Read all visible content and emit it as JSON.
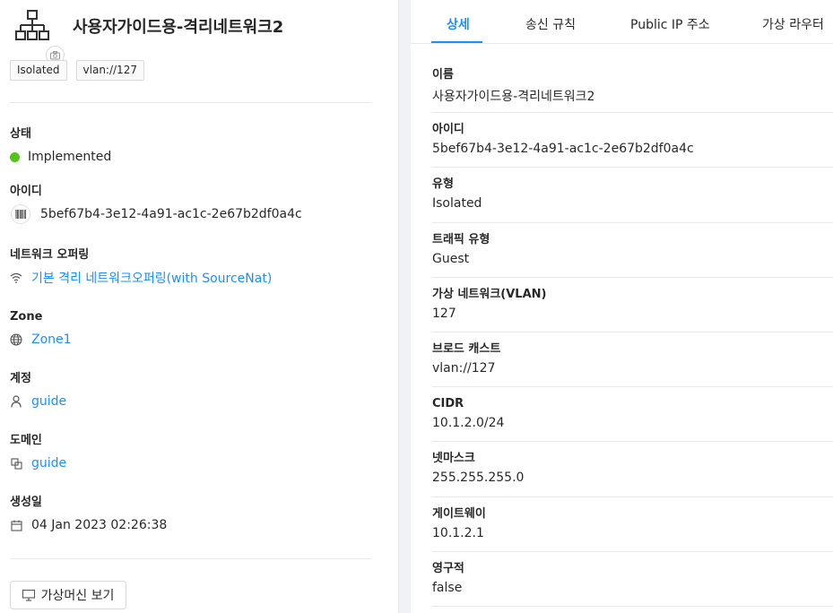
{
  "header": {
    "title": "사용자가이드용-격리네트워크2",
    "tags": [
      "Isolated",
      "vlan://127"
    ]
  },
  "info": {
    "status": {
      "label": "상태",
      "value": "Implemented",
      "color": "#52c41a"
    },
    "id": {
      "label": "아이디",
      "value": "5bef67b4-3e12-4a91-ac1c-2e67b2df0a4c"
    },
    "network_offering": {
      "label": "네트워크 오퍼링",
      "value": "기본 격리 네트워크오퍼링(with SourceNat)"
    },
    "zone": {
      "label": "Zone",
      "value": "Zone1"
    },
    "account": {
      "label": "계정",
      "value": "guide"
    },
    "domain": {
      "label": "도메인",
      "value": "guide"
    },
    "created": {
      "label": "생성일",
      "value": "04 Jan 2023 02:26:38"
    }
  },
  "actions": {
    "view_vms": "가상머신 보기"
  },
  "tabs": [
    "상세",
    "송신 규칙",
    "Public IP 주소",
    "가상 라우터"
  ],
  "details": [
    {
      "label": "이름",
      "value": "사용자가이드용-격리네트워크2"
    },
    {
      "label": "아이디",
      "value": "5bef67b4-3e12-4a91-ac1c-2e67b2df0a4c"
    },
    {
      "label": "유형",
      "value": "Isolated"
    },
    {
      "label": "트래픽 유형",
      "value": "Guest"
    },
    {
      "label": "가상 네트워크(VLAN)",
      "value": "127"
    },
    {
      "label": "브로드 캐스트",
      "value": "vlan://127"
    },
    {
      "label": "CIDR",
      "value": "10.1.2.0/24"
    },
    {
      "label": "넷마스크",
      "value": "255.255.255.0"
    },
    {
      "label": "게이트웨이",
      "value": "10.1.2.1"
    },
    {
      "label": "영구적",
      "value": "false"
    }
  ],
  "colors": {
    "accent": "#1890ff",
    "status_ok": "#52c41a"
  },
  "icons": {
    "header": "network-icon",
    "camera": "camera-icon",
    "id": "barcode-icon",
    "network_offering": "wifi-icon",
    "zone": "globe-icon",
    "account": "user-icon",
    "domain": "block-icon",
    "created": "calendar-icon",
    "view_vms": "desktop-icon"
  }
}
